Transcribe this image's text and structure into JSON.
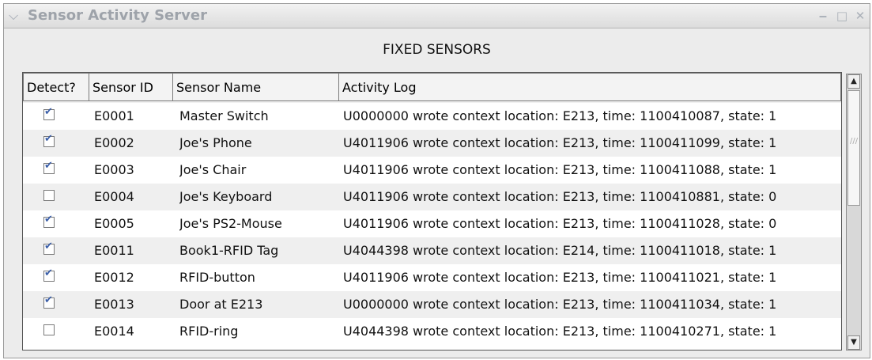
{
  "window": {
    "title": "Sensor Activity Server",
    "controls": {
      "minimize": "‒",
      "maximize": "□",
      "close": "✕"
    }
  },
  "section_title": "FIXED SENSORS",
  "table": {
    "columns": [
      "Detect?",
      "Sensor ID",
      "Sensor Name",
      "Activity Log"
    ],
    "rows": [
      {
        "detect": true,
        "id": "E0001",
        "name": "Master Switch",
        "log": "U0000000 wrote context location: E213, time: 1100410087, state: 1"
      },
      {
        "detect": true,
        "id": "E0002",
        "name": "Joe's Phone",
        "log": "U4011906 wrote context location: E213, time: 1100411099, state: 1"
      },
      {
        "detect": true,
        "id": "E0003",
        "name": "Joe's Chair",
        "log": "U4011906 wrote context location: E213, time: 1100411088, state: 1"
      },
      {
        "detect": false,
        "id": "E0004",
        "name": "Joe's Keyboard",
        "log": "U4011906 wrote context location: E213, time: 1100410881, state: 0"
      },
      {
        "detect": true,
        "id": "E0005",
        "name": "Joe's PS2-Mouse",
        "log": "U4011906 wrote context location: E213, time: 1100411028, state: 0"
      },
      {
        "detect": true,
        "id": "E0011",
        "name": "Book1-RFID Tag",
        "log": "U4044398 wrote context location: E214, time: 1100411018, state: 1"
      },
      {
        "detect": true,
        "id": "E0012",
        "name": "RFID-button",
        "log": "U4011906 wrote context location: E213, time: 1100411021, state: 1"
      },
      {
        "detect": true,
        "id": "E0013",
        "name": "Door at E213",
        "log": "U0000000 wrote context location: E213, time: 1100411034, state: 1"
      },
      {
        "detect": false,
        "id": "E0014",
        "name": "RFID-ring",
        "log": "U4044398 wrote context location: E213, time: 1100410271, state: 1"
      }
    ]
  },
  "scrollbar": {
    "up": "▲",
    "down": "▼"
  }
}
